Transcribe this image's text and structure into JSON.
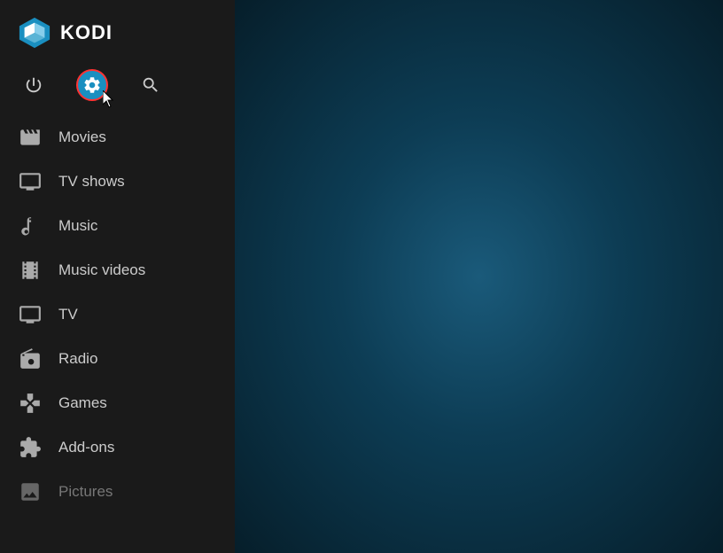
{
  "app": {
    "name": "KODI"
  },
  "topIcons": [
    {
      "id": "power",
      "label": "Power"
    },
    {
      "id": "settings",
      "label": "Settings",
      "active": true
    },
    {
      "id": "search",
      "label": "Search"
    }
  ],
  "navItems": [
    {
      "id": "movies",
      "label": "Movies"
    },
    {
      "id": "tv-shows",
      "label": "TV shows"
    },
    {
      "id": "music",
      "label": "Music"
    },
    {
      "id": "music-videos",
      "label": "Music videos"
    },
    {
      "id": "tv",
      "label": "TV"
    },
    {
      "id": "radio",
      "label": "Radio"
    },
    {
      "id": "games",
      "label": "Games"
    },
    {
      "id": "add-ons",
      "label": "Add-ons"
    },
    {
      "id": "pictures",
      "label": "Pictures",
      "dimmed": true
    }
  ]
}
